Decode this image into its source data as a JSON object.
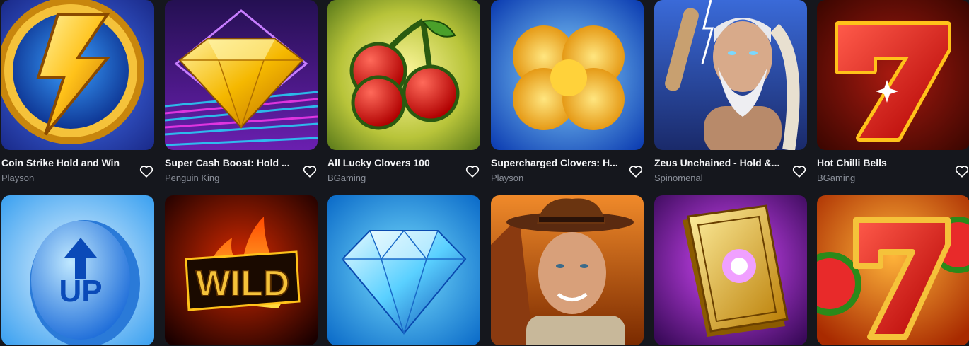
{
  "games": [
    {
      "title": "Coin Strike Hold and Win",
      "provider": "Playson",
      "art": "lightning-coin"
    },
    {
      "title": "Super Cash Boost: Hold ...",
      "provider": "Penguin King",
      "art": "gold-diamond"
    },
    {
      "title": "All Lucky Clovers 100",
      "provider": "BGaming",
      "art": "cherries"
    },
    {
      "title": "Supercharged Clovers: H...",
      "provider": "Playson",
      "art": "golden-clover"
    },
    {
      "title": "Zeus Unchained - Hold &...",
      "provider": "Spinomenal",
      "art": "zeus"
    },
    {
      "title": "Hot Chilli Bells",
      "provider": "BGaming",
      "art": "red-seven"
    },
    {
      "title": "",
      "provider": "",
      "art": "up-coin"
    },
    {
      "title": "",
      "provider": "",
      "art": "wild-fire"
    },
    {
      "title": "",
      "provider": "",
      "art": "blue-diamond"
    },
    {
      "title": "",
      "provider": "",
      "art": "explorer"
    },
    {
      "title": "",
      "provider": "",
      "art": "golden-book"
    },
    {
      "title": "",
      "provider": "",
      "art": "seven-watermelon"
    }
  ],
  "icons": {
    "favorite": "heart-outline-icon"
  },
  "colors": {
    "background": "#15171d",
    "provider_text": "#8a8f99"
  }
}
